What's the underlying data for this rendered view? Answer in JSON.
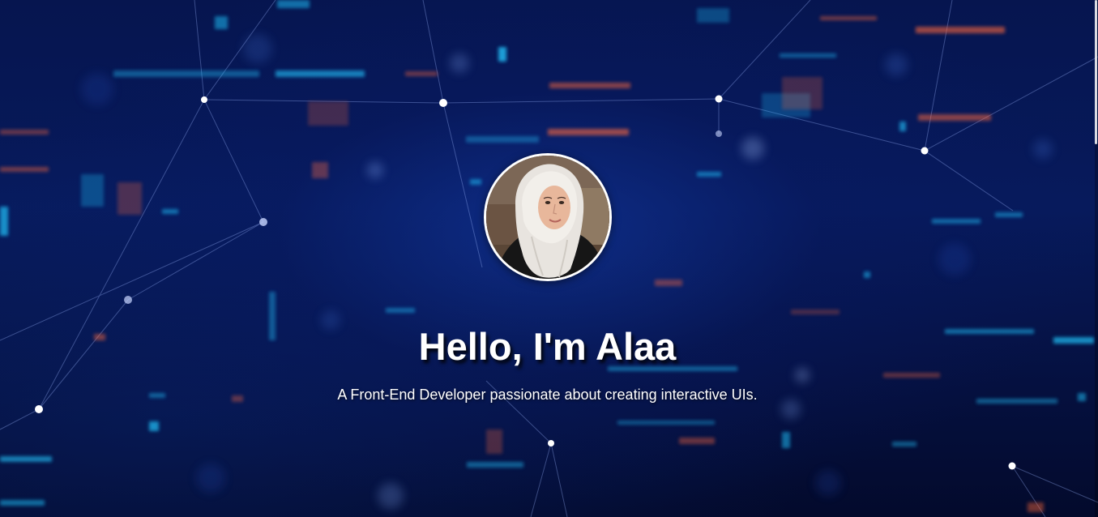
{
  "hero": {
    "title": "Hello, I'm Alaa",
    "subtitle": "A Front-End Developer passionate about creating interactive UIs.",
    "avatar_alt": "Alaa profile photo"
  },
  "icons": {
    "avatar": "profile-photo"
  },
  "colors": {
    "background": "#06154f",
    "accent_cyan": "#22c8ff",
    "accent_orange": "#ff6a3d",
    "text": "#ffffff"
  }
}
